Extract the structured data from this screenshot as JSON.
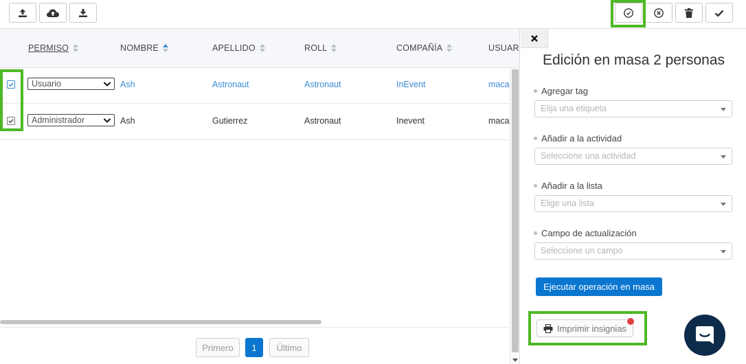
{
  "toolbar": {
    "left_buttons": [
      "upload-icon",
      "cloud-upload-icon",
      "download-icon"
    ],
    "right_buttons": [
      "check-circle-icon",
      "x-circle-icon",
      "trash-icon",
      "checkmark-icon"
    ]
  },
  "table": {
    "columns": [
      "PERMISO",
      "NOMBRE",
      "APELLIDO",
      "ROLL",
      "COMPAÑÍA",
      "USUARIO"
    ],
    "rows": [
      {
        "permission": "Usuario",
        "nombre": "Ash",
        "apellido": "Astronaut",
        "roll": "Astronaut",
        "compania": "InEvent",
        "usuario": "macar",
        "checked": true,
        "linked": true
      },
      {
        "permission": "Administrador",
        "nombre": "Ash",
        "apellido": "Gutierrez",
        "roll": "Astronaut",
        "compania": "Inevent",
        "usuario": "macar",
        "checked": true,
        "linked": false
      }
    ]
  },
  "pagination": {
    "first": "Primero",
    "current": "1",
    "last": "Último"
  },
  "panel": {
    "close_icon": "close-icon",
    "title": "Edición en masa 2 personas",
    "fields": [
      {
        "label": "Agregar tag",
        "placeholder": "Elija una etiqueta"
      },
      {
        "label": "Añadir a la actividad",
        "placeholder": "Seleccione una actividad"
      },
      {
        "label": "Añadir a la lista",
        "placeholder": "Elige una lista"
      },
      {
        "label": "Campo de actualización",
        "placeholder": "Seleccione un campo"
      }
    ],
    "execute_label": "Ejecutar operación en masa",
    "print_label": "Imprimir insignias"
  },
  "colors": {
    "accent": "#0a76cf",
    "link": "#3a8ad1",
    "highlight": "#4db825",
    "chat": "#0d2b4a",
    "badge": "#e04040"
  }
}
